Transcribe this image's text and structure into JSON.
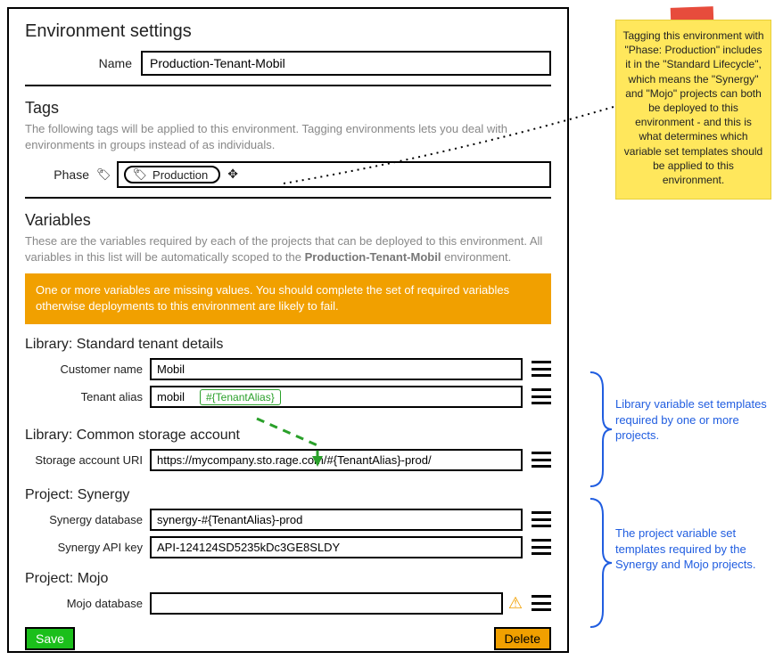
{
  "header": {
    "title": "Environment settings"
  },
  "name": {
    "label": "Name",
    "value": "Production-Tenant-Mobil"
  },
  "tags": {
    "title": "Tags",
    "desc": "The following tags will be applied to this environment. Tagging environments lets you deal with environments in groups instead of as individuals.",
    "category_label": "Phase",
    "pill_value": "Production"
  },
  "variables": {
    "title": "Variables",
    "desc_pre": "These are the variables required by each of the projects that can be deployed to this environment. All variables in this list will be automatically scoped to the ",
    "desc_bold": "Production-Tenant-Mobil",
    "desc_post": " environment.",
    "warning": "One or more variables are missing values. You should complete the set of required variables otherwise deployments to this environment are likely to fail."
  },
  "groups": {
    "lib_std": {
      "title": "Library: Standard tenant details"
    },
    "lib_common": {
      "title": "Library: Common storage account"
    },
    "proj_synergy": {
      "title": "Project: Synergy"
    },
    "proj_mojo": {
      "title": "Project: Mojo"
    }
  },
  "fields": {
    "customer_name": {
      "label": "Customer name",
      "value": "Mobil"
    },
    "tenant_alias": {
      "label": "Tenant alias",
      "value": "mobil",
      "chip": "#{TenantAlias}"
    },
    "storage_uri": {
      "label": "Storage account URI",
      "value": "https://mycompany.sto.rage.com/#{TenantAlias}-prod/"
    },
    "synergy_db": {
      "label": "Synergy database",
      "value": "synergy-#{TenantAlias}-prod"
    },
    "synergy_api": {
      "label": "Synergy API key",
      "value": "API-124124SD5235kDc3GE8SLDY"
    },
    "mojo_db": {
      "label": "Mojo database",
      "value": ""
    }
  },
  "buttons": {
    "save": "Save",
    "delete": "Delete"
  },
  "sticky": {
    "text": "Tagging this environment with \"Phase: Production\" includes it in the \"Standard Lifecycle\", which means the \"Synergy\" and \"Mojo\" projects can both be deployed to this environment - and this is what determines which variable set templates should be applied to this environment."
  },
  "callouts": {
    "lib": "Library variable set templates required by one or more projects.",
    "proj": "The project variable set templates required by the Synergy and Mojo projects."
  }
}
